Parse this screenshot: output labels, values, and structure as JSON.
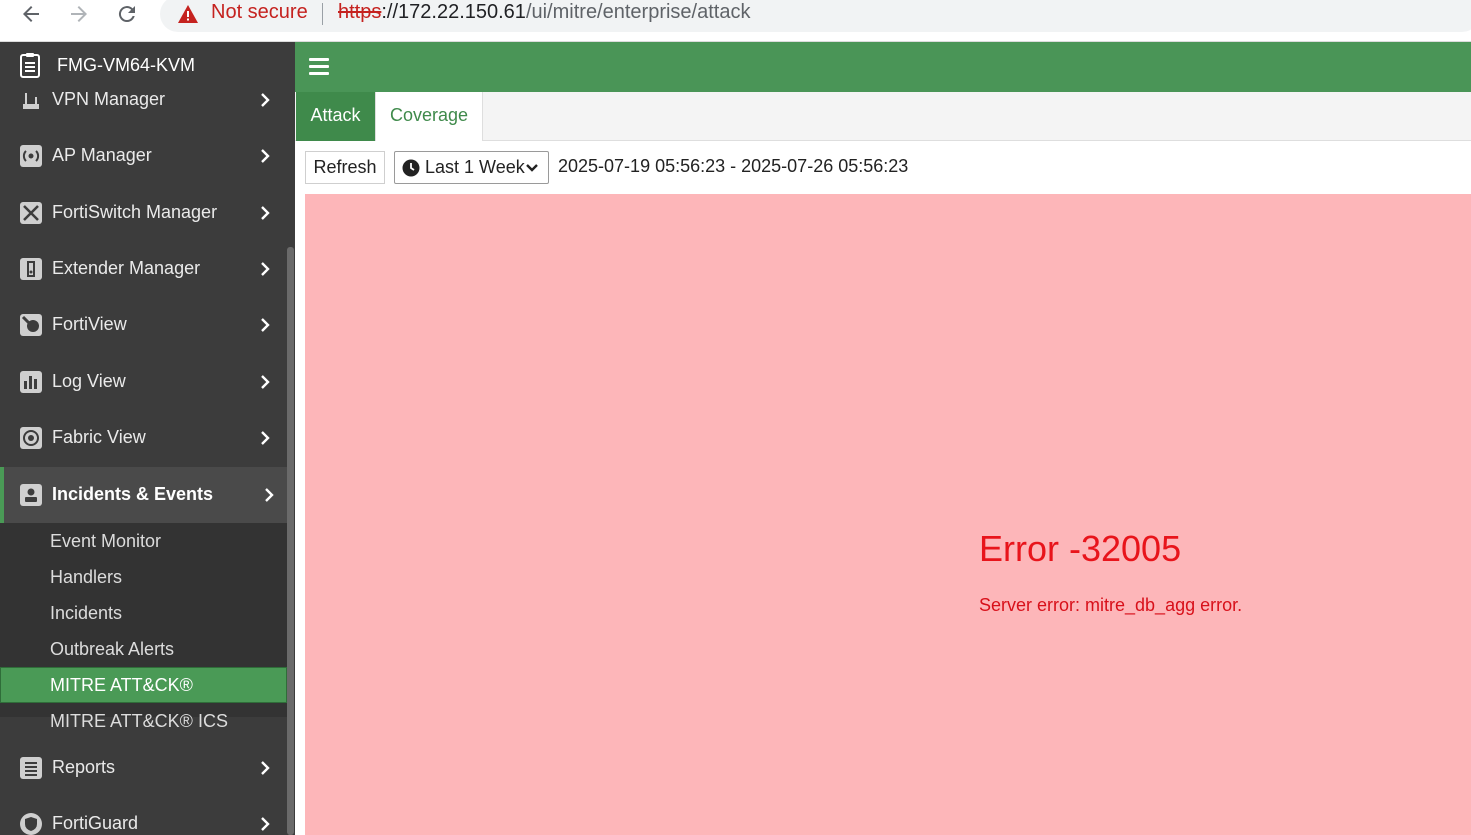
{
  "browser": {
    "not_secure": "Not secure",
    "url_scheme": "https",
    "url_host": "://172.22.150.61",
    "url_path": "/ui/mitre/enterprise/attack"
  },
  "sidebar": {
    "device_name": "FMG-VM64-KVM",
    "items": [
      {
        "label": "VPN Manager",
        "icon": "vpn-icon"
      },
      {
        "label": "AP Manager",
        "icon": "wifi-icon"
      },
      {
        "label": "FortiSwitch Manager",
        "icon": "switch-icon"
      },
      {
        "label": "Extender Manager",
        "icon": "extender-icon"
      },
      {
        "label": "FortiView",
        "icon": "fortiview-icon"
      },
      {
        "label": "Log View",
        "icon": "bar-chart-icon"
      },
      {
        "label": "Fabric View",
        "icon": "fabric-icon"
      },
      {
        "label": "Incidents & Events",
        "icon": "incidents-icon"
      },
      {
        "label": "Reports",
        "icon": "reports-icon"
      },
      {
        "label": "FortiGuard",
        "icon": "shield-icon"
      }
    ],
    "subitems": [
      {
        "label": "Event Monitor"
      },
      {
        "label": "Handlers"
      },
      {
        "label": "Incidents"
      },
      {
        "label": "Outbreak Alerts"
      },
      {
        "label": "MITRE ATT&CK®"
      },
      {
        "label": "MITRE ATT&CK® ICS"
      }
    ]
  },
  "tabs": [
    {
      "label": "Attack"
    },
    {
      "label": "Coverage"
    }
  ],
  "toolbar": {
    "refresh_label": "Refresh",
    "range_value": "Last 1 Week",
    "date_range": "2025-07-19 05:56:23 - 2025-07-26 05:56:23"
  },
  "error": {
    "title": "Error -32005",
    "message": "Server error: mitre_db_agg error."
  },
  "colors": {
    "header_green": "#4a9557",
    "error_bg": "#fdb6b9",
    "error_text": "#e8141b",
    "sidebar_bg": "#3c3c3c"
  }
}
